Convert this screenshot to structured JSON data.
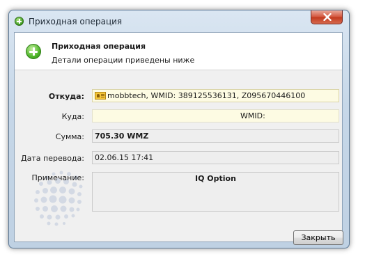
{
  "window": {
    "title": "Приходная операция",
    "icon": "green-plus-icon"
  },
  "header": {
    "title": "Приходная операция",
    "subtitle": "Детали операции приведены ниже",
    "icon": "green-plus-icon"
  },
  "form": {
    "from_label": "Откуда:",
    "from_value": "mobbtech, WMID: 389125536131, Z095670446100",
    "from_icon": "wallet-id-icon",
    "to_label": "Куда:",
    "to_value": "WMID:",
    "amount_label": "Сумма:",
    "amount_value": "705.30 WMZ",
    "date_label": "Дата перевода:",
    "date_value": "02.06.15 17:41",
    "note_label": "Примечание:",
    "note_value": "IQ Option"
  },
  "buttons": {
    "close_label": "Закрыть"
  },
  "colors": {
    "title_bar": "#c6d7e8",
    "close_button": "#c23a1e",
    "from_field_bg": "#fdfbe3",
    "plus_icon": "#4fb52b"
  }
}
